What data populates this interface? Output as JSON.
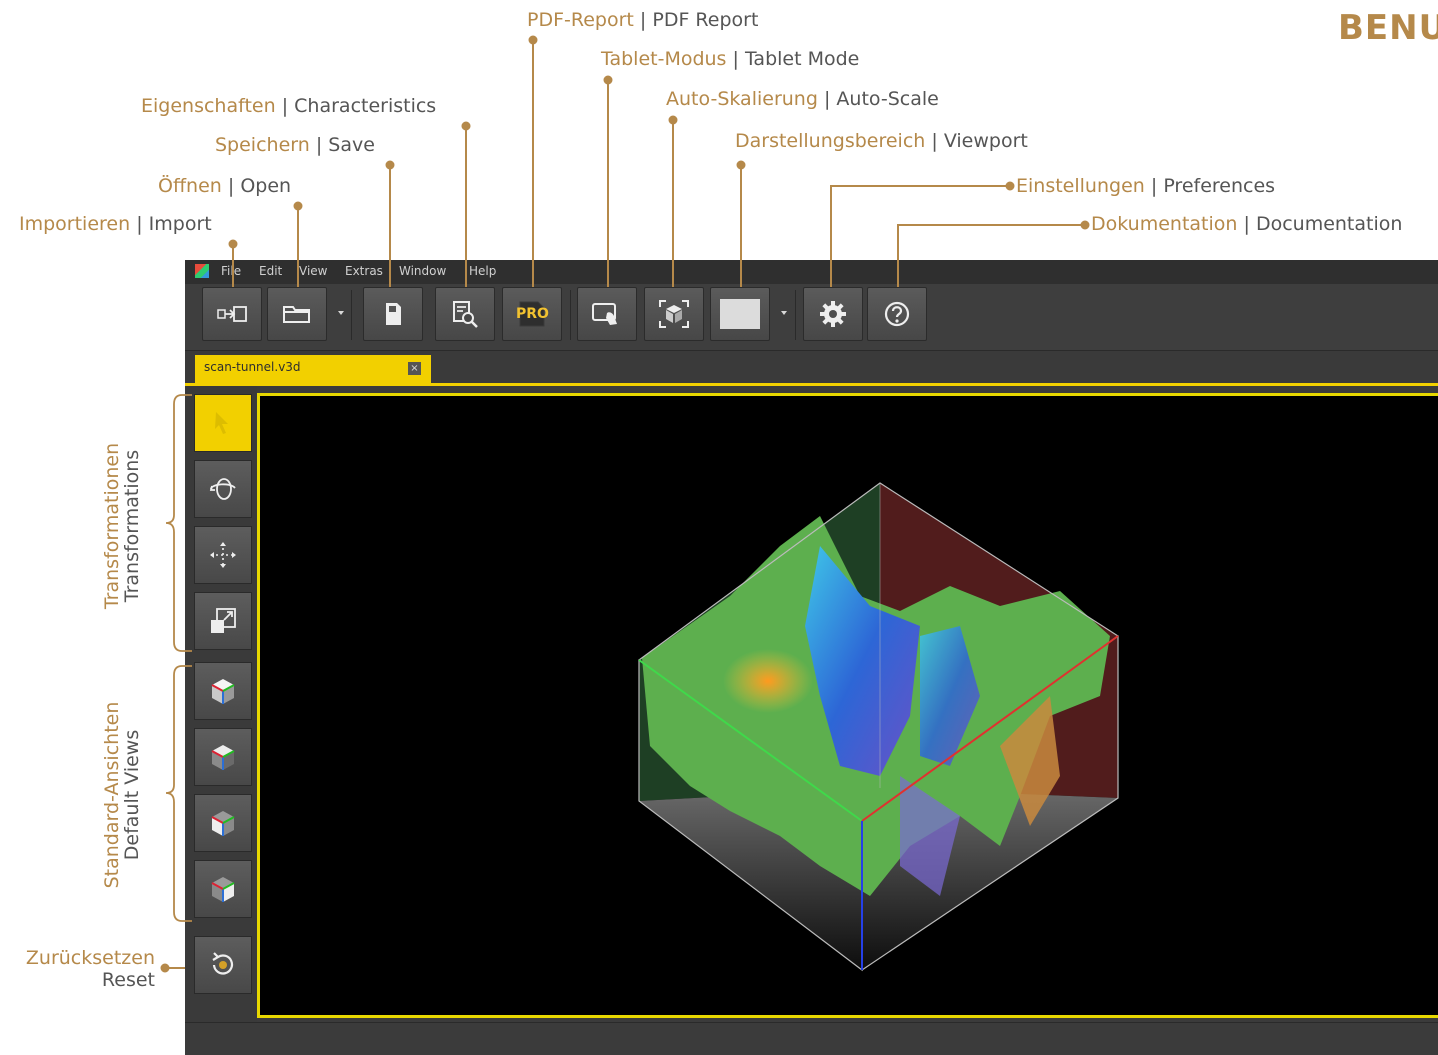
{
  "heading": "BENU",
  "colors": {
    "accent_gold": "#b5894a",
    "tab_yellow": "#f2d000",
    "viewport_border": "#e8d800"
  },
  "callouts": {
    "pdf_report": {
      "de": "PDF-Report",
      "en": "PDF Report"
    },
    "tablet_mode": {
      "de": "Tablet-Modus",
      "en": "Tablet Mode"
    },
    "auto_scale": {
      "de": "Auto-Skalierung",
      "en": "Auto-Scale"
    },
    "characteristics": {
      "de": "Eigenschaften",
      "en": "Characteristics"
    },
    "viewport": {
      "de": "Darstellungsbereich",
      "en": "Viewport"
    },
    "save": {
      "de": "Speichern",
      "en": "Save"
    },
    "preferences": {
      "de": "Einstellungen",
      "en": "Preferences"
    },
    "open": {
      "de": "Öffnen",
      "en": "Open"
    },
    "import": {
      "de": "Importieren",
      "en": "Import"
    },
    "documentation": {
      "de": "Dokumentation",
      "en": "Documentation"
    },
    "transformations": {
      "de": "Transformationen",
      "en": "Transformations"
    },
    "default_views": {
      "de": "Standard-Ansichten",
      "en": "Default Views"
    },
    "reset": {
      "de": "Zurücksetzen",
      "en": "Reset"
    },
    "separator": "|"
  },
  "app": {
    "menu": [
      "File",
      "Edit",
      "View",
      "Extras",
      "Window",
      "Help"
    ],
    "pro_badge": "PRO",
    "tab": {
      "label": "scan-tunnel.v3d",
      "close": "×"
    },
    "toolbar_icons": [
      "import-icon",
      "open-folder-icon",
      "save-icon",
      "characteristics-icon",
      "pdf-report-icon",
      "tablet-mode-icon",
      "auto-scale-icon",
      "viewport-color-icon",
      "gear-icon",
      "help-icon"
    ],
    "sidebar_icons": [
      "pointer-icon",
      "rotate-icon",
      "move-icon",
      "scale-icon",
      "view-iso-icon",
      "view-top-icon",
      "view-front-icon",
      "view-side-icon",
      "reset-icon"
    ]
  }
}
